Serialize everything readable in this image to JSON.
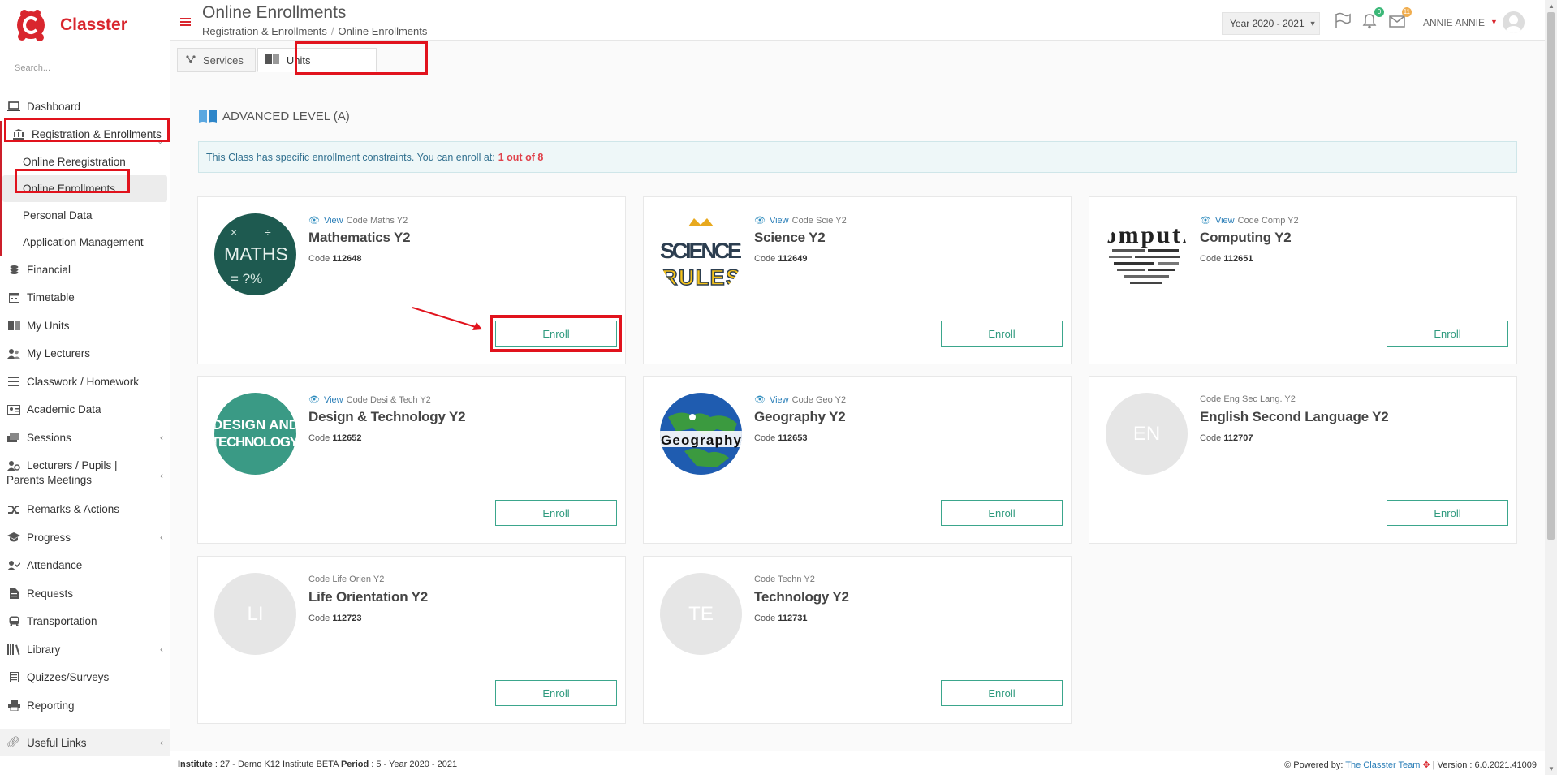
{
  "app": {
    "name": "Classter",
    "search_placeholder": "Search..."
  },
  "sidebar": {
    "items": [
      {
        "label": "Dashboard",
        "icon": "laptop-icon"
      },
      {
        "label": "Registration & Enrollments",
        "icon": "institution-icon"
      },
      {
        "label": "Financial",
        "icon": "coins-icon"
      },
      {
        "label": "Timetable",
        "icon": "calendar-icon"
      },
      {
        "label": "My Units",
        "icon": "book-icon"
      },
      {
        "label": "My Lecturers",
        "icon": "users-icon"
      },
      {
        "label": "Classwork / Homework",
        "icon": "list-icon"
      },
      {
        "label": "Academic Data",
        "icon": "id-card-icon"
      },
      {
        "label": "Sessions",
        "icon": "sessions-icon"
      },
      {
        "label": "Lecturers / Pupils | Parents Meetings",
        "icon": "meeting-icon"
      },
      {
        "label": "Remarks & Actions",
        "icon": "shuffle-icon"
      },
      {
        "label": "Progress",
        "icon": "graduation-cap-icon"
      },
      {
        "label": "Attendance",
        "icon": "user-check-icon"
      },
      {
        "label": "Requests",
        "icon": "document-icon"
      },
      {
        "label": "Transportation",
        "icon": "bus-icon"
      },
      {
        "label": "Library",
        "icon": "library-icon"
      },
      {
        "label": "Quizzes/Surveys",
        "icon": "quiz-icon"
      },
      {
        "label": "Reporting",
        "icon": "print-icon"
      }
    ],
    "sub_items": [
      {
        "label": "Online Reregistration"
      },
      {
        "label": "Online Enrollments"
      },
      {
        "label": "Personal Data"
      },
      {
        "label": "Application Management"
      }
    ],
    "useful_links": "Useful Links"
  },
  "header": {
    "title": "Online Enrollments",
    "breadcrumb": [
      "Registration & Enrollments",
      "Online Enrollments"
    ],
    "year": "Year 2020 - 2021",
    "notifications_count": "0",
    "messages_count": "11",
    "user_name": "ANNIE ANNIE"
  },
  "tabs": [
    {
      "label": "Services"
    },
    {
      "label": "Units"
    }
  ],
  "section": {
    "title": "ADVANCED LEVEL (A)",
    "alert_text": "This Class has specific enrollment constraints. You can enroll at:",
    "alert_highlight": "1 out of 8"
  },
  "units": [
    {
      "name": "Mathematics Y2",
      "view": "View",
      "code_label": "Code Maths Y2",
      "code_prefix": "Code",
      "code": "112648",
      "enroll": "Enroll",
      "image": "maths"
    },
    {
      "name": "Science Y2",
      "view": "View",
      "code_label": "Code Scie Y2",
      "code_prefix": "Code",
      "code": "112649",
      "enroll": "Enroll",
      "image": "science"
    },
    {
      "name": "Computing Y2",
      "view": "View",
      "code_label": "Code Comp Y2",
      "code_prefix": "Code",
      "code": "112651",
      "enroll": "Enroll",
      "image": "computing"
    },
    {
      "name": "Design & Technology Y2",
      "view": "View",
      "code_label": "Code Desi & Tech Y2",
      "code_prefix": "Code",
      "code": "112652",
      "enroll": "Enroll",
      "image": "design"
    },
    {
      "name": "Geography Y2",
      "view": "View",
      "code_label": "Code Geo Y2",
      "code_prefix": "Code",
      "code": "112653",
      "enroll": "Enroll",
      "image": "geography"
    },
    {
      "name": "English Second Language Y2",
      "code_label": "Code Eng Sec Lang. Y2",
      "code_prefix": "Code",
      "code": "112707",
      "enroll": "Enroll",
      "initials": "EN"
    },
    {
      "name": "Life Orientation Y2",
      "code_label": "Code Life Orien Y2",
      "code_prefix": "Code",
      "code": "112723",
      "enroll": "Enroll",
      "initials": "LI"
    },
    {
      "name": "Technology Y2",
      "code_label": "Code Techn Y2",
      "code_prefix": "Code",
      "code": "112731",
      "enroll": "Enroll",
      "initials": "TE"
    }
  ],
  "footer": {
    "institute_label": "Institute",
    "institute": ": 27 - Demo K12 Institute BETA",
    "period_label": "Period",
    "period": ": 5 - Year 2020 - 2021",
    "powered_by": "Powered by:",
    "team": "The Classter Team",
    "version": "| Version : 6.0.2021.41009"
  },
  "colors": {
    "brand": "#d9262e",
    "enroll": "#2f9a7e",
    "link": "#2c7fb8",
    "highlight": "#e1131d"
  }
}
